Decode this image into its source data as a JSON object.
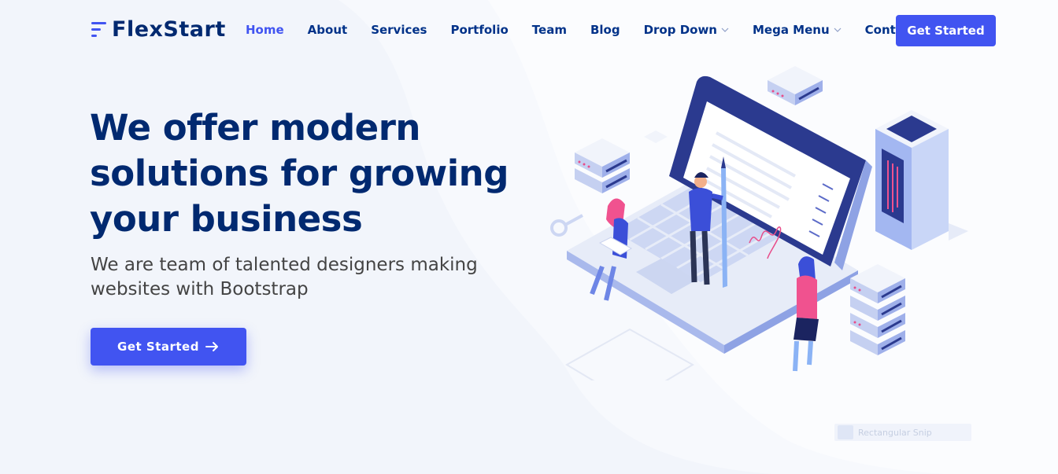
{
  "header": {
    "logo": "FlexStart",
    "nav": [
      {
        "label": "Home",
        "active": true
      },
      {
        "label": "About"
      },
      {
        "label": "Services"
      },
      {
        "label": "Portfolio"
      },
      {
        "label": "Team"
      },
      {
        "label": "Blog"
      },
      {
        "label": "Drop Down",
        "dropdown": true
      },
      {
        "label": "Mega Menu",
        "dropdown": true
      },
      {
        "label": "Contact"
      }
    ],
    "cta_label": "Get Started"
  },
  "hero": {
    "title": "We offer modern solutions for growing your business",
    "subtitle": "We are team of talented designers making websites with Bootstrap",
    "button_label": "Get Started",
    "button_icon": "arrow-right-icon"
  },
  "overlay": {
    "label": "Rectangular Snip"
  },
  "colors": {
    "accent": "#4154f1",
    "heading": "#012970",
    "nav_text": "#013289",
    "body_text": "#444444",
    "background": "#f2f5fb"
  }
}
